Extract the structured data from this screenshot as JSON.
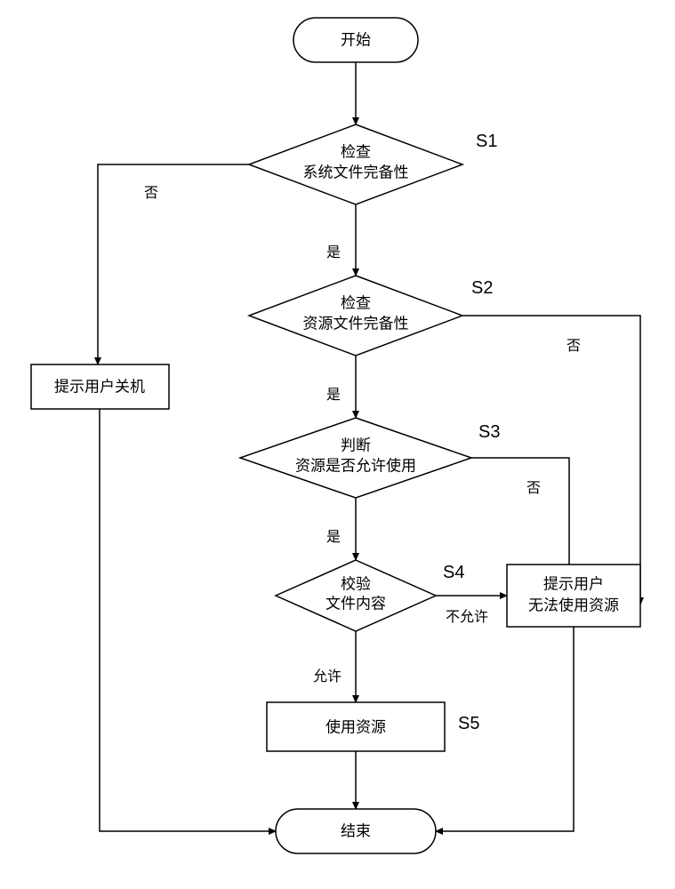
{
  "terminals": {
    "start": "开始",
    "end": "结束"
  },
  "decisions": {
    "s1": {
      "label": "S1",
      "line1": "检查",
      "line2": "系统文件完备性"
    },
    "s2": {
      "label": "S2",
      "line1": "检查",
      "line2": "资源文件完备性"
    },
    "s3": {
      "label": "S3",
      "line1": "判断",
      "line2": "资源是否允许使用"
    },
    "s4": {
      "label": "S4",
      "line1": "校验",
      "line2": "文件内容"
    }
  },
  "processes": {
    "shutdown": "提示用户关机",
    "cannot_use": {
      "line1": "提示用户",
      "line2": "无法使用资源"
    },
    "use_resource": {
      "text": "使用资源",
      "label": "S5"
    }
  },
  "edges": {
    "yes": "是",
    "no": "否",
    "allow": "允许",
    "not_allow": "不允许"
  }
}
